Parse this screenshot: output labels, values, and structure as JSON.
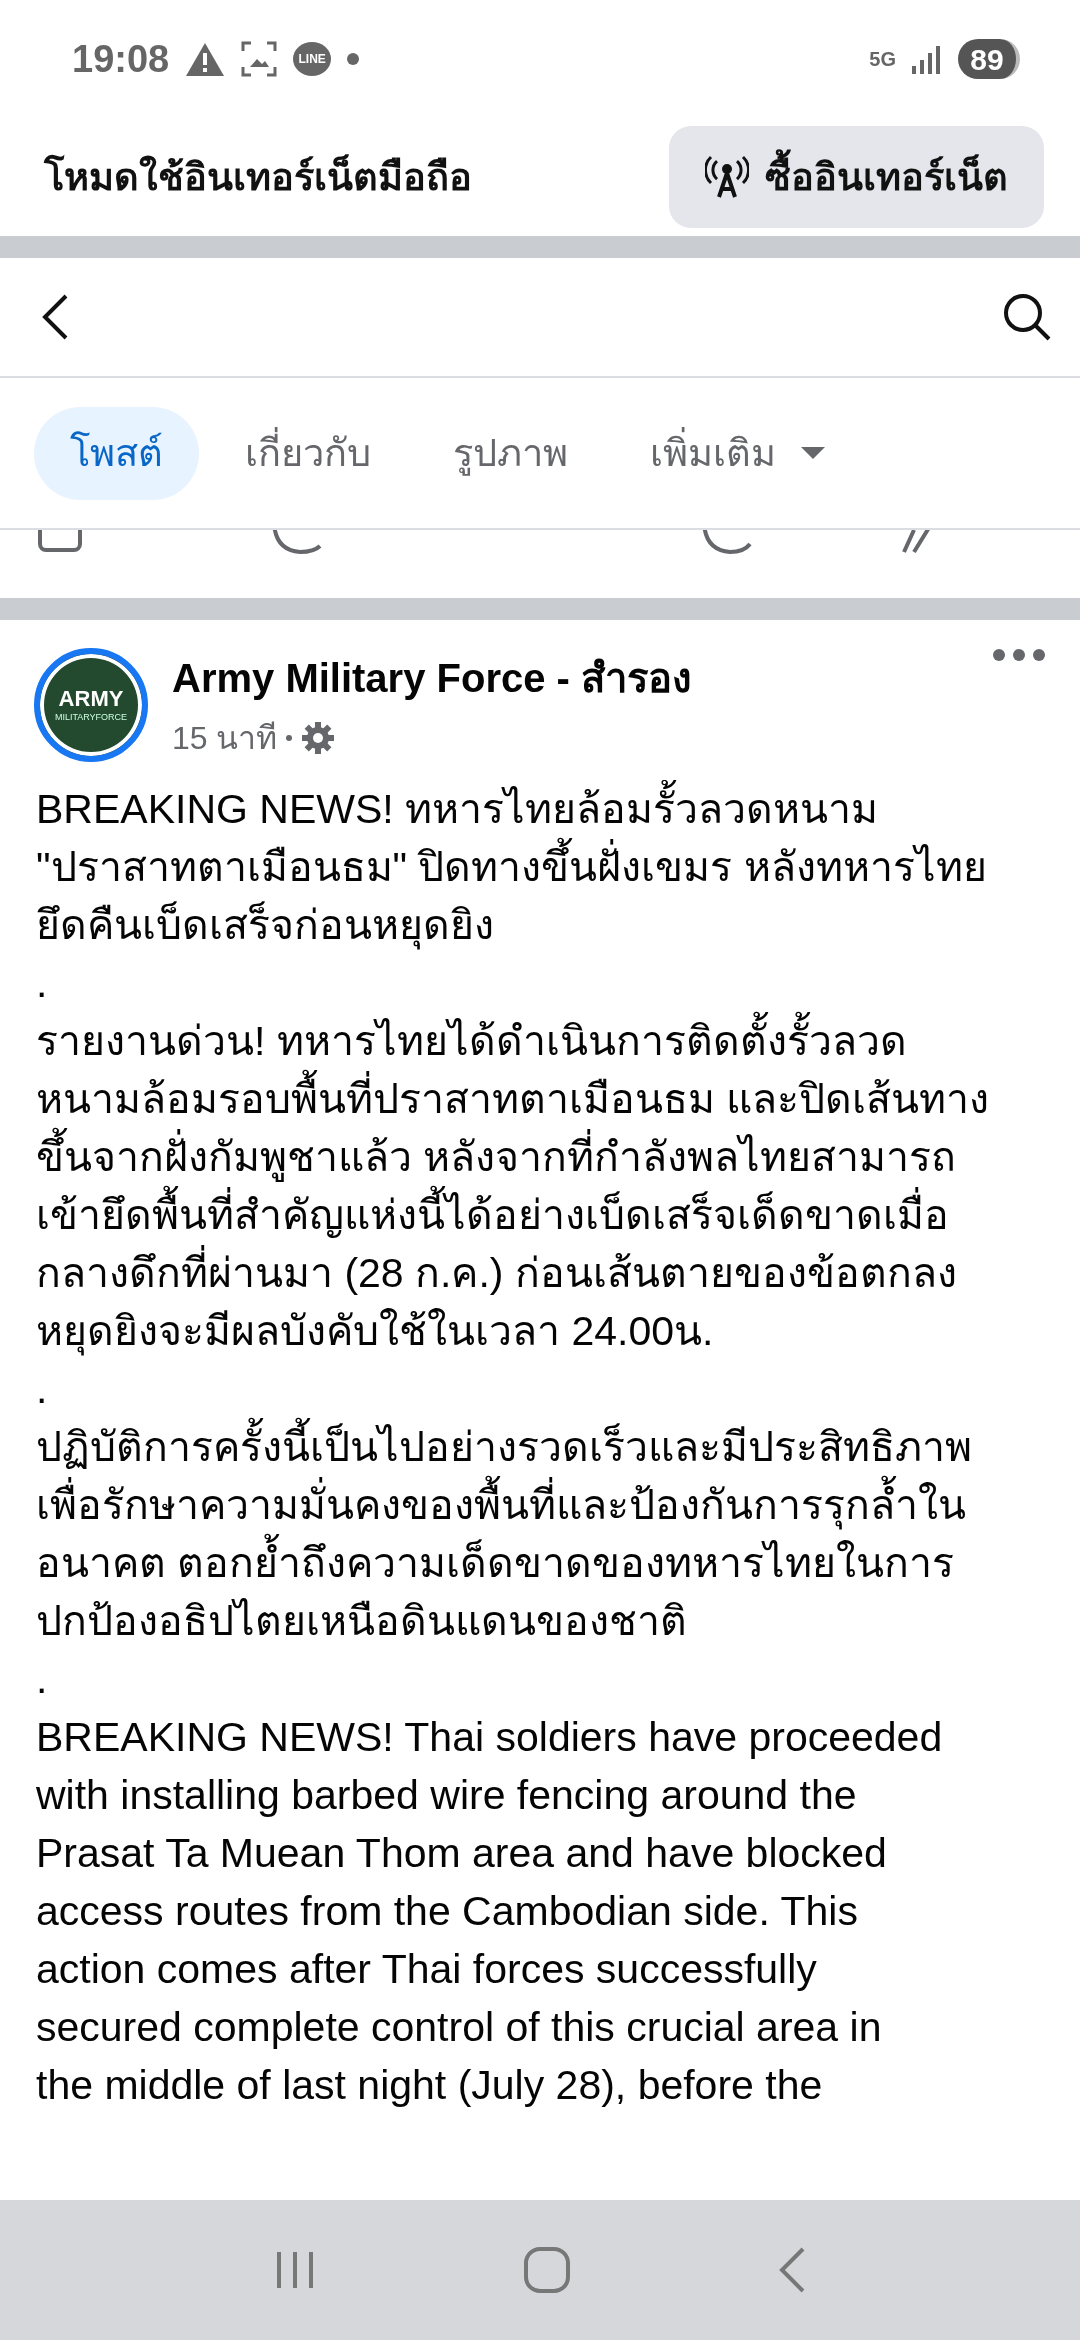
{
  "status_bar": {
    "time": "19:08",
    "line_badge": "LINE",
    "network": "5G",
    "battery": "89"
  },
  "data_banner": {
    "label": "โหมดใช้อินเทอร์เน็ตมือถือ",
    "button": "ซื้ออินเทอร์เน็ต"
  },
  "tabs": [
    {
      "label": "โพสต์",
      "selected": true
    },
    {
      "label": "เกี่ยวกับ",
      "selected": false
    },
    {
      "label": "รูปภาพ",
      "selected": false
    },
    {
      "label": "เพิ่มเติม",
      "selected": false,
      "dropdown": true
    }
  ],
  "post": {
    "avatar": {
      "title": "ARMY",
      "subtitle": "MILITARYFORCE"
    },
    "author": "Army Military Force - สำรอง",
    "time": "15 นาที",
    "body_lines": [
      "BREAKING NEWS! ทหารไทยล้อมรั้วลวดหนาม",
      "\"ปราสาทตาเมือนธม\" ปิดทางขึ้นฝั่งเขมร หลังทหารไทย",
      "ยึดคืนเบ็ดเสร็จก่อนหยุดยิง",
      ".",
      "รายงานด่วน! ทหารไทยได้ดำเนินการติดตั้งรั้วลวด",
      "หนามล้อมรอบพื้นที่ปราสาทตาเมือนธม และปิดเส้นทาง",
      "ขึ้นจากฝั่งกัมพูชาแล้ว หลังจากที่กำลังพลไทยสามารถ",
      "เข้ายึดพื้นที่สำคัญแห่งนี้ได้อย่างเบ็ดเสร็จเด็ดขาดเมื่อ",
      "กลางดึกที่ผ่านมา (28 ก.ค.) ก่อนเส้นตายของข้อตกลง",
      "หยุดยิงจะมีผลบังคับใช้ในเวลา 24.00น.",
      ".",
      "ปฏิบัติการครั้งนี้เป็นไปอย่างรวดเร็วและมีประสิทธิภาพ",
      "เพื่อรักษาความมั่นคงของพื้นที่และป้องกันการรุกล้ำใน",
      "อนาคต ตอกย้ำถึงความเด็ดขาดของทหารไทยในการ",
      "ปกป้องอธิปไตยเหนือดินแดนของชาติ",
      ".",
      "BREAKING NEWS! Thai soldiers have proceeded",
      "with installing barbed wire fencing around the",
      "Prasat Ta Muean Thom area and have blocked",
      "access routes from the Cambodian side. This",
      "action comes after Thai forces successfully",
      "secured complete control of this crucial area in",
      "the middle of last night (July 28), before the"
    ]
  }
}
